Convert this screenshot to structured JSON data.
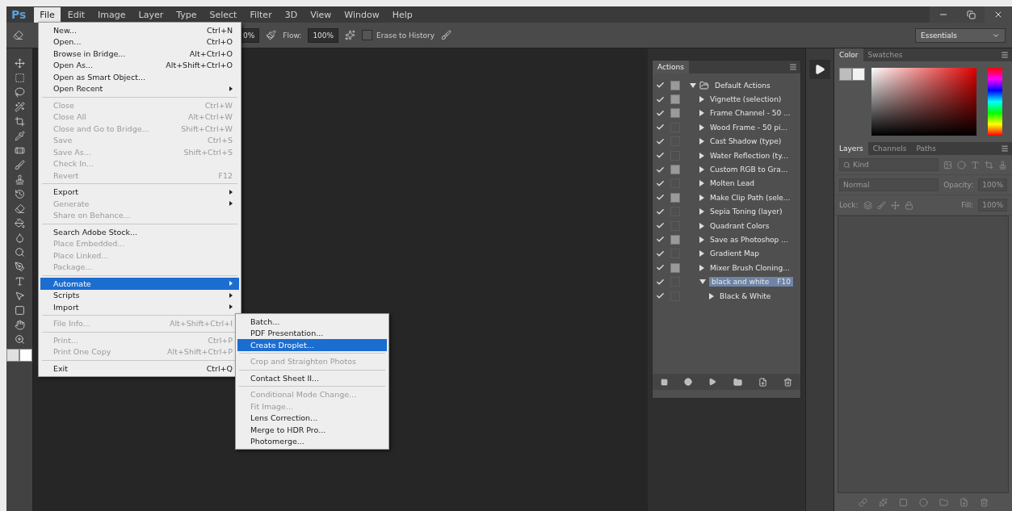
{
  "app": {
    "logo": "Ps",
    "menus": [
      {
        "label": "File",
        "selected": true
      },
      {
        "label": "Edit",
        "selected": false
      },
      {
        "label": "Image",
        "selected": false
      },
      {
        "label": "Layer",
        "selected": false
      },
      {
        "label": "Type",
        "selected": false
      },
      {
        "label": "Select",
        "selected": false
      },
      {
        "label": "Filter",
        "selected": false
      },
      {
        "label": "3D",
        "selected": false
      },
      {
        "label": "View",
        "selected": false
      },
      {
        "label": "Window",
        "selected": false
      },
      {
        "label": "Help",
        "selected": false
      }
    ]
  },
  "options_bar": {
    "opacity_value": "0%",
    "flow_label": "Flow:",
    "flow_value": "100%",
    "erase_to_history": {
      "label": "Erase to History",
      "checked": false
    },
    "workspace": "Essentials"
  },
  "file_menu": {
    "items": [
      {
        "kind": "item",
        "label": "New...",
        "shortcut": "Ctrl+N",
        "disabled": false,
        "submenu": false,
        "selected": false
      },
      {
        "kind": "item",
        "label": "Open...",
        "shortcut": "Ctrl+O",
        "disabled": false,
        "submenu": false,
        "selected": false
      },
      {
        "kind": "item",
        "label": "Browse in Bridge...",
        "shortcut": "Alt+Ctrl+O",
        "disabled": false,
        "submenu": false,
        "selected": false
      },
      {
        "kind": "item",
        "label": "Open As...",
        "shortcut": "Alt+Shift+Ctrl+O",
        "disabled": false,
        "submenu": false,
        "selected": false
      },
      {
        "kind": "item",
        "label": "Open as Smart Object...",
        "disabled": false,
        "submenu": false,
        "selected": false
      },
      {
        "kind": "item",
        "label": "Open Recent",
        "disabled": false,
        "submenu": true,
        "selected": false
      },
      {
        "kind": "separator"
      },
      {
        "kind": "item",
        "label": "Close",
        "shortcut": "Ctrl+W",
        "disabled": true,
        "submenu": false,
        "selected": false
      },
      {
        "kind": "item",
        "label": "Close All",
        "shortcut": "Alt+Ctrl+W",
        "disabled": true,
        "submenu": false,
        "selected": false
      },
      {
        "kind": "item",
        "label": "Close and Go to Bridge...",
        "shortcut": "Shift+Ctrl+W",
        "disabled": true,
        "submenu": false,
        "selected": false
      },
      {
        "kind": "item",
        "label": "Save",
        "shortcut": "Ctrl+S",
        "disabled": true,
        "submenu": false,
        "selected": false
      },
      {
        "kind": "item",
        "label": "Save As...",
        "shortcut": "Shift+Ctrl+S",
        "disabled": true,
        "submenu": false,
        "selected": false
      },
      {
        "kind": "item",
        "label": "Check In...",
        "disabled": true,
        "submenu": false,
        "selected": false
      },
      {
        "kind": "item",
        "label": "Revert",
        "shortcut": "F12",
        "disabled": true,
        "submenu": false,
        "selected": false
      },
      {
        "kind": "separator"
      },
      {
        "kind": "item",
        "label": "Export",
        "disabled": false,
        "submenu": true,
        "selected": false
      },
      {
        "kind": "item",
        "label": "Generate",
        "disabled": true,
        "submenu": true,
        "selected": false
      },
      {
        "kind": "item",
        "label": "Share on Behance...",
        "disabled": true,
        "submenu": false,
        "selected": false
      },
      {
        "kind": "separator"
      },
      {
        "kind": "item",
        "label": "Search Adobe Stock...",
        "disabled": false,
        "submenu": false,
        "selected": false
      },
      {
        "kind": "item",
        "label": "Place Embedded...",
        "disabled": true,
        "submenu": false,
        "selected": false
      },
      {
        "kind": "item",
        "label": "Place Linked...",
        "disabled": true,
        "submenu": false,
        "selected": false
      },
      {
        "kind": "item",
        "label": "Package...",
        "disabled": true,
        "submenu": false,
        "selected": false
      },
      {
        "kind": "separator"
      },
      {
        "kind": "item",
        "label": "Automate",
        "disabled": false,
        "submenu": true,
        "selected": true
      },
      {
        "kind": "item",
        "label": "Scripts",
        "disabled": false,
        "submenu": true,
        "selected": false
      },
      {
        "kind": "item",
        "label": "Import",
        "disabled": false,
        "submenu": true,
        "selected": false
      },
      {
        "kind": "separator"
      },
      {
        "kind": "item",
        "label": "File Info...",
        "shortcut": "Alt+Shift+Ctrl+I",
        "disabled": true,
        "submenu": false,
        "selected": false
      },
      {
        "kind": "separator"
      },
      {
        "kind": "item",
        "label": "Print...",
        "shortcut": "Ctrl+P",
        "disabled": true,
        "submenu": false,
        "selected": false
      },
      {
        "kind": "item",
        "label": "Print One Copy",
        "shortcut": "Alt+Shift+Ctrl+P",
        "disabled": true,
        "submenu": false,
        "selected": false
      },
      {
        "kind": "separator"
      },
      {
        "kind": "item",
        "label": "Exit",
        "shortcut": "Ctrl+Q",
        "disabled": false,
        "submenu": false,
        "selected": false
      }
    ]
  },
  "automate_menu": {
    "items": [
      {
        "kind": "item",
        "label": "Batch...",
        "disabled": false,
        "selected": false
      },
      {
        "kind": "item",
        "label": "PDF Presentation...",
        "disabled": false,
        "selected": false
      },
      {
        "kind": "item",
        "label": "Create Droplet...",
        "disabled": false,
        "selected": true
      },
      {
        "kind": "separator"
      },
      {
        "kind": "item",
        "label": "Crop and Straighten Photos",
        "disabled": true,
        "selected": false
      },
      {
        "kind": "separator"
      },
      {
        "kind": "item",
        "label": "Contact Sheet II...",
        "disabled": false,
        "selected": false
      },
      {
        "kind": "separator"
      },
      {
        "kind": "item",
        "label": "Conditional Mode Change...",
        "disabled": true,
        "selected": false
      },
      {
        "kind": "item",
        "label": "Fit Image...",
        "disabled": true,
        "selected": false
      },
      {
        "kind": "item",
        "label": "Lens Correction...",
        "disabled": false,
        "selected": false
      },
      {
        "kind": "item",
        "label": "Merge to HDR Pro...",
        "disabled": false,
        "selected": false
      },
      {
        "kind": "item",
        "label": "Photomerge...",
        "disabled": false,
        "selected": false
      }
    ]
  },
  "actions_panel": {
    "tab": "Actions",
    "items": [
      {
        "name": "Default Actions",
        "kind": "set",
        "enabled": true,
        "dialog": true,
        "expanded": true,
        "selected": false,
        "children": [
          {
            "name": "Vignette (selection)",
            "kind": "action",
            "enabled": true,
            "dialog": true,
            "expanded": false,
            "selected": false
          },
          {
            "name": "Frame Channel - 50 ...",
            "kind": "action",
            "enabled": true,
            "dialog": true,
            "expanded": false,
            "selected": false
          },
          {
            "name": "Wood Frame - 50 pi...",
            "kind": "action",
            "enabled": true,
            "dialog": false,
            "expanded": false,
            "selected": false
          },
          {
            "name": "Cast Shadow (type)",
            "kind": "action",
            "enabled": true,
            "dialog": false,
            "expanded": false,
            "selected": false
          },
          {
            "name": "Water Reflection (ty...",
            "kind": "action",
            "enabled": true,
            "dialog": false,
            "expanded": false,
            "selected": false
          },
          {
            "name": "Custom RGB to Gra...",
            "kind": "action",
            "enabled": true,
            "dialog": true,
            "expanded": false,
            "selected": false
          },
          {
            "name": "Molten Lead",
            "kind": "action",
            "enabled": true,
            "dialog": false,
            "expanded": false,
            "selected": false
          },
          {
            "name": "Make Clip Path (sele...",
            "kind": "action",
            "enabled": true,
            "dialog": true,
            "expanded": false,
            "selected": false
          },
          {
            "name": "Sepia Toning (layer)",
            "kind": "action",
            "enabled": true,
            "dialog": false,
            "expanded": false,
            "selected": false
          },
          {
            "name": "Quadrant Colors",
            "kind": "action",
            "enabled": true,
            "dialog": false,
            "expanded": false,
            "selected": false
          },
          {
            "name": "Save as Photoshop ...",
            "kind": "action",
            "enabled": true,
            "dialog": true,
            "expanded": false,
            "selected": false
          },
          {
            "name": "Gradient Map",
            "kind": "action",
            "enabled": true,
            "dialog": false,
            "expanded": false,
            "selected": false
          },
          {
            "name": "Mixer Brush Cloning...",
            "kind": "action",
            "enabled": true,
            "dialog": true,
            "expanded": false,
            "selected": false
          },
          {
            "name": "black and white",
            "kind": "action",
            "shortcut": "F10",
            "enabled": true,
            "dialog": false,
            "expanded": true,
            "selected": true,
            "children": [
              {
                "name": "Black & White",
                "kind": "step",
                "enabled": true,
                "dialog": false,
                "expanded": false,
                "selected": false
              }
            ]
          }
        ]
      }
    ]
  },
  "color_panel": {
    "tabs": [
      {
        "label": "Color",
        "selected": true
      },
      {
        "label": "Swatches",
        "selected": false
      }
    ]
  },
  "layers_panel": {
    "tabs": [
      {
        "label": "Layers",
        "selected": true
      },
      {
        "label": "Channels",
        "selected": false
      },
      {
        "label": "Paths",
        "selected": false
      }
    ],
    "filter": "Kind",
    "blend_mode": "Normal",
    "opacity_label": "Opacity:",
    "opacity_value": "100%",
    "lock_label": "Lock:",
    "fill_label": "Fill:",
    "fill_value": "100%"
  }
}
